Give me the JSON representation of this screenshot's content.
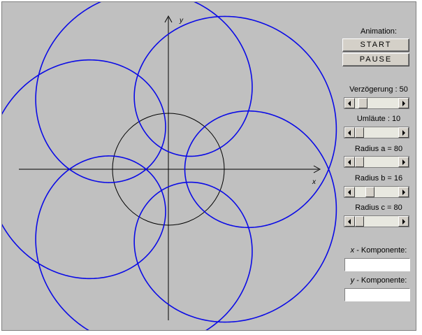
{
  "plot": {
    "x_axis_label": "x",
    "y_axis_label": "y",
    "colors": {
      "curve": "#0a0ae6",
      "axes": "#000000",
      "base_circle": "#000000"
    }
  },
  "controls": {
    "animation_label": "Animation:",
    "start_label": "START",
    "pause_label": "PAUSE",
    "delay": {
      "label": "Verzögerung : 50",
      "value": 50,
      "position": 0.1
    },
    "laps": {
      "label": "Umläute : 10",
      "value": 10,
      "position": 0.0
    },
    "radius_a": {
      "label": "Radius a = 80",
      "value": 80,
      "position": 0.0
    },
    "radius_b": {
      "label": "Radius b = 16",
      "value": 16,
      "position": 0.3
    },
    "radius_c": {
      "label": "Radius c = 80",
      "value": 80,
      "position": 0.0
    }
  },
  "outputs": {
    "x_component_var": "x",
    "x_component_label": " - Komponente:",
    "x_component_value": "",
    "y_component_var": "y",
    "y_component_label": " - Komponente:",
    "y_component_value": ""
  }
}
